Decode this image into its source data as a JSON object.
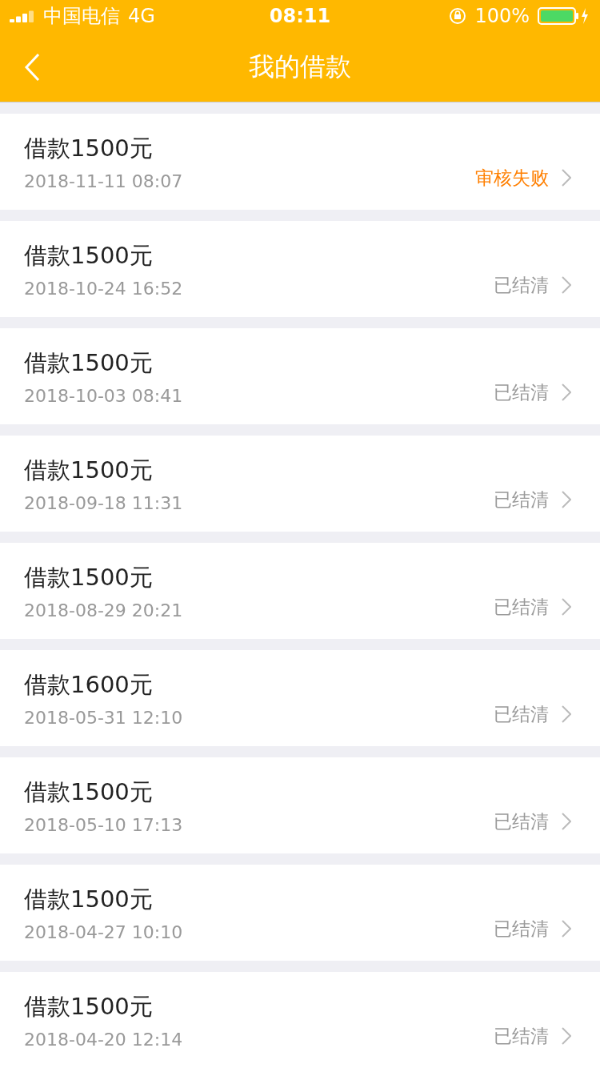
{
  "status_bar": {
    "carrier": "中国电信",
    "network": "4G",
    "time": "08:11",
    "battery": "100%"
  },
  "header": {
    "title": "我的借款"
  },
  "loans": [
    {
      "title": "借款1500元",
      "date": "2018-11-11 08:07",
      "status": "审核失败",
      "kind": "failed"
    },
    {
      "title": "借款1500元",
      "date": "2018-10-24 16:52",
      "status": "已结清",
      "kind": "settled"
    },
    {
      "title": "借款1500元",
      "date": "2018-10-03 08:41",
      "status": "已结清",
      "kind": "settled"
    },
    {
      "title": "借款1500元",
      "date": "2018-09-18 11:31",
      "status": "已结清",
      "kind": "settled"
    },
    {
      "title": "借款1500元",
      "date": "2018-08-29 20:21",
      "status": "已结清",
      "kind": "settled"
    },
    {
      "title": "借款1600元",
      "date": "2018-05-31 12:10",
      "status": "已结清",
      "kind": "settled"
    },
    {
      "title": "借款1500元",
      "date": "2018-05-10 17:13",
      "status": "已结清",
      "kind": "settled"
    },
    {
      "title": "借款1500元",
      "date": "2018-04-27 10:10",
      "status": "已结清",
      "kind": "settled"
    },
    {
      "title": "借款1500元",
      "date": "2018-04-20 12:14",
      "status": "已结清",
      "kind": "settled"
    }
  ]
}
